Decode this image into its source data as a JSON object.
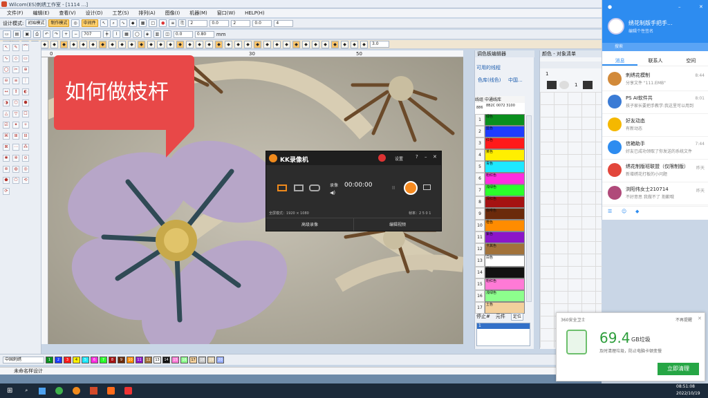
{
  "window": {
    "title": "Wilcom(ES)刺绣工作室 - [1114 ...]"
  },
  "menu": [
    "文件(F)",
    "编辑(E)",
    "查看(V)",
    "设计(D)",
    "工艺(S)",
    "排列(A)",
    "图像(I)",
    "机器(M)",
    "窗口(W)",
    "HELP(H)"
  ],
  "toolbar1": {
    "mode_label": "设计模式:",
    "mode_btn1": "初始模式",
    "mode_btn2": "制作模式",
    "btn3": "中间件"
  },
  "toolbar2": {
    "zoom_value": "707",
    "field1": "2",
    "field2": "0.0",
    "field3": "0.0",
    "field4": "2",
    "field5": "0.0",
    "field6": "4",
    "field7": "0.80",
    "unit": "mm"
  },
  "toolbar3": {
    "stitch_value": "3.0",
    "font_value": "公制"
  },
  "ruler": {
    "marks": [
      "0",
      "30",
      "50"
    ]
  },
  "callout": {
    "text": "如何做枝杆"
  },
  "kk": {
    "title": "KK录像机",
    "settings": "设置",
    "help": "?",
    "minimize": "–",
    "close": "✕",
    "record_label": "录像",
    "timer": "00:00:00",
    "fullscreen": "全屏模式：1920 × 1080",
    "frame": "帧率：2 5 0 1",
    "btn_left": "高级录像",
    "btn_right": "编辑视频"
  },
  "color_panel": {
    "title": "调色板编辑器",
    "sub_title": "可用的线程",
    "tab1": "色库(线色)",
    "tab2": "中国...",
    "header_idx": "线组",
    "header_name": "中通线库",
    "meta1": "886",
    "meta2": "8B2C 0072 3100",
    "rows": [
      {
        "idx": "1",
        "name": "绿色",
        "color": "#0a8f1e"
      },
      {
        "idx": "2",
        "name": "蓝色",
        "color": "#1e3cff"
      },
      {
        "idx": "3",
        "name": "红色",
        "color": "#ff1a1a"
      },
      {
        "idx": "4",
        "name": "黄色",
        "color": "#ffef00"
      },
      {
        "idx": "5",
        "name": "青色",
        "color": "#1ee8ff"
      },
      {
        "idx": "6",
        "name": "粉红色",
        "color": "#ff2de0"
      },
      {
        "idx": "7",
        "name": "浅绿色",
        "color": "#2bff2b"
      },
      {
        "idx": "8",
        "name": "深红色",
        "color": "#a51212"
      },
      {
        "idx": "9",
        "name": "咖啡色",
        "color": "#6b2a0b"
      },
      {
        "idx": "10",
        "name": "橙色",
        "color": "#ff8c00"
      },
      {
        "idx": "11",
        "name": "紫色",
        "color": "#8b16c9"
      },
      {
        "idx": "12",
        "name": "卡其色",
        "color": "#a2723a"
      },
      {
        "idx": "13",
        "name": "白色",
        "color": "#ffffff"
      },
      {
        "idx": "14",
        "name": "黑色",
        "color": "#111111"
      },
      {
        "idx": "15",
        "name": "粉红色",
        "color": "#ff7ad6"
      },
      {
        "idx": "16",
        "name": "浅绿色",
        "color": "#8dff8d"
      },
      {
        "idx": "17",
        "name": "土色",
        "color": "#f3d09c"
      }
    ],
    "footer_a": "停止#",
    "footer_b": "元件",
    "footer_c": "定位",
    "footer_val": "1"
  },
  "seq_panel": {
    "title": "颜色 - 对象清单",
    "col1": "1",
    "col2": "1"
  },
  "bottom": {
    "combo": "中国刺绣",
    "palette": [
      "1",
      "2",
      "3",
      "4",
      "5",
      "6",
      "7",
      "8",
      "9",
      "10",
      "11",
      "12",
      "13",
      "14",
      "15",
      "16",
      "17",
      "18",
      "19",
      "20"
    ],
    "palette_colors": [
      "#0a8f1e",
      "#1e3cff",
      "#ff1a1a",
      "#ffef00",
      "#1ee8ff",
      "#ff2de0",
      "#2bff2b",
      "#a51212",
      "#6b2a0b",
      "#ff8c00",
      "#8b16c9",
      "#a2723a",
      "#ffffff",
      "#111111",
      "#ff7ad6",
      "#8dff8d",
      "#f3d09c",
      "#c8c8c8",
      "#e0d0b0",
      "#9ab0ff"
    ]
  },
  "status": {
    "text": "未命名样设计"
  },
  "qq": {
    "name": "绣花制版手把手...",
    "signature": "编辑个性签名",
    "search": "搜索",
    "tabs": [
      "消息",
      "联系人",
      "空间"
    ],
    "items": [
      {
        "name": "刺绣花模制",
        "msg": "分享文件 \"111.EMB\"",
        "time": "8:44",
        "color": "#d28a3a"
      },
      {
        "name": "PS AI软件共",
        "msg": "孩子家长要把手教学:我这里可以用到",
        "time": "8:01",
        "color": "#3a7bd5"
      },
      {
        "name": "好友动态",
        "msg": "有新动态",
        "time": "",
        "color": "#f5b800"
      },
      {
        "name": "信箱助手",
        "msg": "好友已成功领取了你发送的系统文件",
        "time": "7:44",
        "color": "#2d8cf0"
      },
      {
        "name": "绣花制版班联盟（仅限制版）",
        "msg": "新增绣花打板的小问题",
        "time": "昨天",
        "color": "#e2463b"
      },
      {
        "name": "浏阳伟女士210714",
        "msg": "不好意思 我做不了 抱歉哦",
        "time": "昨天",
        "color": "#b04a7a"
      }
    ]
  },
  "security": {
    "app": "360安全卫士",
    "dismiss": "不再提醒",
    "amount": "69.4",
    "unit": "GB垃圾",
    "desc": "及时清理垃圾，防止电脑卡顿变慢",
    "action": "立即清理"
  },
  "taskbar": {
    "time": "08:51:08",
    "date": "2022/10/19"
  }
}
